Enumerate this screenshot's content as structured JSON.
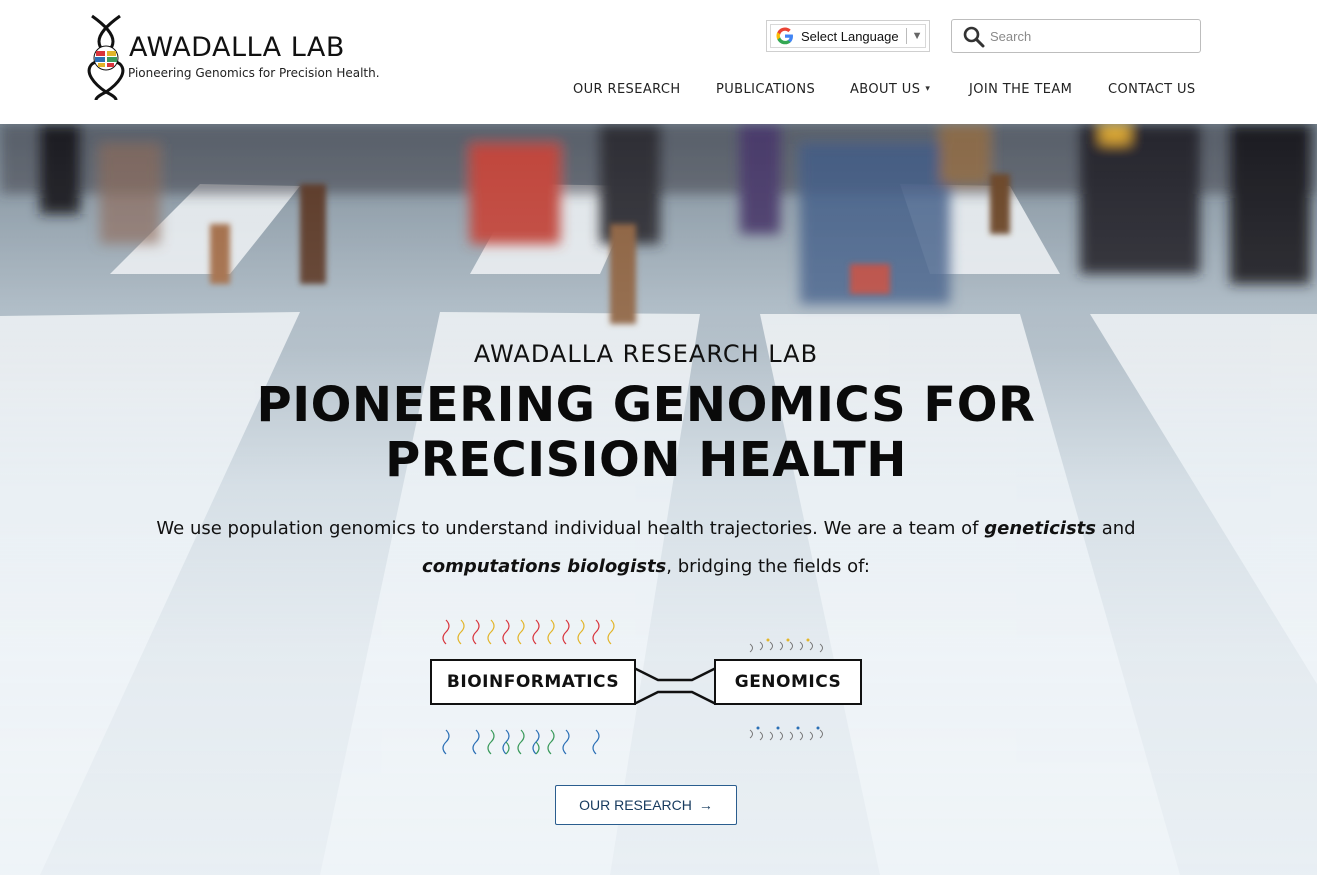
{
  "brand": {
    "name": "AWADALLA LAB",
    "tagline": "Pioneering Genomics for Precision Health."
  },
  "translate": {
    "label": "Select Language",
    "arrow": "▼"
  },
  "search": {
    "placeholder": "Search"
  },
  "nav": {
    "items": [
      {
        "label": "OUR RESEARCH"
      },
      {
        "label": "PUBLICATIONS"
      },
      {
        "label": "ABOUT US",
        "caret": "▾"
      },
      {
        "label": "JOIN THE TEAM"
      },
      {
        "label": "CONTACT US"
      }
    ]
  },
  "hero": {
    "kicker": "AWADALLA RESEARCH LAB",
    "headline_line1": "PIONEERING GENOMICS FOR",
    "headline_line2": "PRECISION HEALTH",
    "text_part1": "We use population genomics to understand individual health trajectories. We are a team of ",
    "text_em1": "geneticists",
    "text_part2": " and ",
    "text_em2": "computations biologists",
    "text_part3": ", bridging the fields of:",
    "field_left": "BIOINFORMATICS",
    "field_right": "GENOMICS",
    "cta_label": "OUR RESEARCH",
    "cta_arrow": "→"
  },
  "colors": {
    "accent": "#2a5d8e",
    "helix_red": "#d8343c",
    "helix_yellow": "#e2b52a",
    "helix_blue": "#2b6fb5",
    "helix_green": "#3a9a5b"
  },
  "icons": [
    "dna-logo-icon",
    "google-icon",
    "search-icon",
    "dropdown-caret-icon",
    "arrow-right-icon"
  ]
}
